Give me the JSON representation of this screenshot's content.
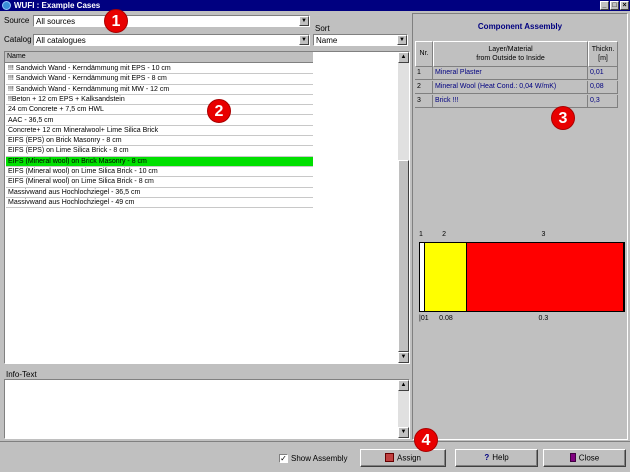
{
  "window": {
    "title": "WUFI : Example Cases"
  },
  "source": {
    "label": "Source",
    "value": "All sources"
  },
  "catalog": {
    "label": "Catalog",
    "value": "All catalogues"
  },
  "sort": {
    "label": "Sort",
    "value": "Name"
  },
  "list": {
    "header": "Name",
    "items": [
      "!!! Sandwich Wand - Kerndämmung mit EPS - 10 cm",
      "!!! Sandwich Wand - Kerndämmung mit EPS - 8 cm",
      "!!! Sandwich Wand - Kerndämmung mit MW - 12 cm",
      "!!Beton + 12 cm EPS + Kalksandstein",
      "24 cm Concrete + 7,5 cm HWL",
      "AAC - 36,5 cm",
      "Concrete+ 12 cm Mineralwool+ Lime Silica Brick",
      "EIFS (EPS) on Brick Masonry - 8 cm",
      "EIFS (EPS) on Lime Silica Brick - 8 cm",
      "EIFS (Mineral wool) on Brick Masonry - 8 cm",
      "EIFS (Mineral wool) on Lime Silica Brick - 10 cm",
      "EIFS (Mineral wool) on Lime Silica Brick - 8 cm",
      "Massivwand aus Hochlochziegel - 36,5 cm",
      "Massivwand aus Hochlochziegel - 49 cm"
    ],
    "selected_index": 9
  },
  "info": {
    "label": "Info-Text"
  },
  "assembly": {
    "title": "Component Assembly",
    "columns": {
      "nr": "Nr.",
      "layer_line1": "Layer/Material",
      "layer_line2": "from Outside to Inside",
      "thick_line1": "Thickn.",
      "thick_line2": "[m]"
    },
    "rows": [
      {
        "nr": "1",
        "name": "Mineral Plaster",
        "thickness": "0,01"
      },
      {
        "nr": "2",
        "name": "Mineral Wool (Heat Cond.: 0,04 W/mK)",
        "thickness": "0,08"
      },
      {
        "nr": "3",
        "name": "Brick !!!",
        "thickness": "0,3"
      }
    ]
  },
  "diagram": {
    "top_labels": [
      "1",
      "2",
      "3"
    ],
    "bottom_labels": [
      "|01",
      "0.08",
      "0.3"
    ],
    "layers": [
      {
        "thickness": 0.01,
        "color": "#ffffff"
      },
      {
        "thickness": 0.08,
        "color": "#ffff00"
      },
      {
        "thickness": 0.3,
        "color": "#ff0000"
      }
    ]
  },
  "footer": {
    "show_assembly_label": "Show Assembly",
    "show_assembly_checked": "✓",
    "assign_label": "Assign",
    "help_label": "Help",
    "close_label": "Close"
  },
  "badges": [
    "1",
    "2",
    "3",
    "4"
  ]
}
